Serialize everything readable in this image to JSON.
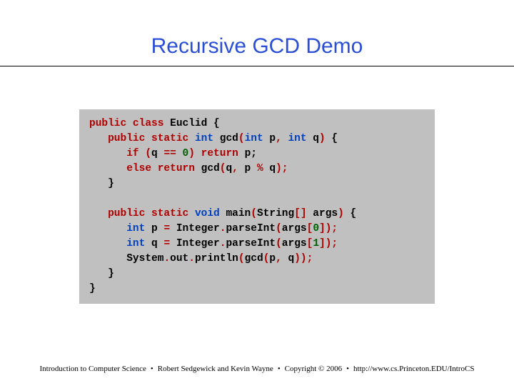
{
  "title": "Recursive GCD Demo",
  "code": {
    "l1": {
      "a": "public class",
      "b": " Euclid ",
      "c": "{"
    },
    "l2": {
      "a": "public static ",
      "b": "int",
      "c": " gcd",
      "d": "(",
      "e": "int",
      "f": " p",
      "g": ",",
      "h": " int",
      "i": " q",
      "j": ")",
      "k": " {"
    },
    "l3": {
      "a": "if ",
      "b": "(",
      "c": "q ",
      "d": "==",
      "e": " 0",
      "f": ")",
      "g": " return",
      "h": " p",
      "i": ";"
    },
    "l4": {
      "a": "else return",
      "b": " gcd",
      "c": "(",
      "d": "q",
      "e": ",",
      "f": " p ",
      "g": "%",
      "h": " q",
      "i": ");"
    },
    "l5": {
      "a": "}"
    },
    "l7": {
      "a": "public static ",
      "b": "void",
      "c": " main",
      "d": "(",
      "e": "String",
      "f": "[]",
      "g": " args",
      "h": ")",
      "i": " {"
    },
    "l8": {
      "a": "int",
      "b": " p ",
      "c": "=",
      "d": " Integer",
      "e": ".",
      "f": "parseInt",
      "g": "(",
      "h": "args",
      "i": "[",
      "j": "0",
      "k": "]);"
    },
    "l9": {
      "a": "int",
      "b": " q ",
      "c": "=",
      "d": " Integer",
      "e": ".",
      "f": "parseInt",
      "g": "(",
      "h": "args",
      "i": "[",
      "j": "1",
      "k": "]);"
    },
    "l10": {
      "a": "System",
      "b": ".",
      "c": "out",
      "d": ".",
      "e": "println",
      "f": "(",
      "g": "gcd",
      "h": "(",
      "i": "p",
      "j": ",",
      "k": " q",
      "l": "));"
    },
    "l11": {
      "a": "}"
    },
    "l12": {
      "a": "}"
    }
  },
  "footer": {
    "course": "Introduction to Computer Science",
    "authors": "Robert Sedgewick and Kevin Wayne",
    "copyright": "Copyright © 2006",
    "url": "http://www.cs.Princeton.EDU/IntroCS",
    "sep": "•"
  }
}
